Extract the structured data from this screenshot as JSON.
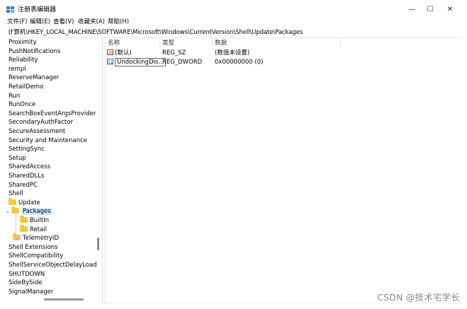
{
  "window": {
    "title": "注册表编辑器",
    "minimize": "—",
    "maximize": "☐",
    "close": "✕"
  },
  "menu": [
    "文件(F)",
    "编辑(E)",
    "查看(V)",
    "收藏夹(A)",
    "帮助(H)"
  ],
  "address": "计算机\\HKEY_LOCAL_MACHINE\\SOFTWARE\\Microsoft\\Windows\\CurrentVersion\\Shell\\Update\\Packages",
  "tree": {
    "items": [
      {
        "label": "Proximity"
      },
      {
        "label": "PushNotifications"
      },
      {
        "label": "Reliability"
      },
      {
        "label": "rempl"
      },
      {
        "label": "ReserveManager"
      },
      {
        "label": "RetailDemo"
      },
      {
        "label": "Run"
      },
      {
        "label": "RunOnce"
      },
      {
        "label": "SearchBoxEventArgsProvider"
      },
      {
        "label": "SecondaryAuthFactor"
      },
      {
        "label": "SecureAssessment"
      },
      {
        "label": "Security and Maintenance"
      },
      {
        "label": "SettingSync"
      },
      {
        "label": "Setup"
      },
      {
        "label": "SharedAccess"
      },
      {
        "label": "SharedDLLs"
      },
      {
        "label": "SharedPC"
      },
      {
        "label": "Shell"
      },
      {
        "label": "Update"
      },
      {
        "label": "Packages"
      },
      {
        "label": "BuiltIn"
      },
      {
        "label": "Retail"
      },
      {
        "label": "TelemetryID"
      },
      {
        "label": "Shell Extensions"
      },
      {
        "label": "ShellCompatibility"
      },
      {
        "label": "ShellServiceObjectDelayLoad"
      },
      {
        "label": "SHUTDOWN"
      },
      {
        "label": "SideBySide"
      },
      {
        "label": "SignalManager"
      }
    ]
  },
  "list": {
    "headers": {
      "name": "名称",
      "type": "类型",
      "data": "数据"
    },
    "rows": [
      {
        "name": "(默认)",
        "type": "REG_SZ",
        "data": "(数值未设置)"
      },
      {
        "name": "UndockingDis...",
        "type": "REG_DWORD",
        "data": "0x00000000 (0)"
      }
    ]
  },
  "watermark": "CSDN @技术宅学长",
  "colors": {
    "folder": "#f6c94d",
    "selection": "#cce8ff"
  }
}
